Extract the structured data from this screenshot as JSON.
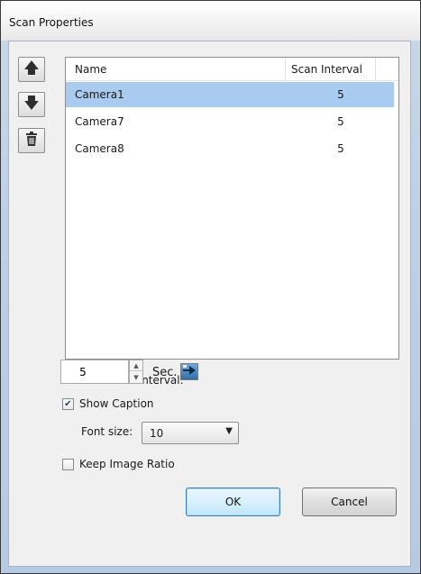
{
  "window": {
    "title": "Scan Properties"
  },
  "toolbar": {
    "move_up_icon": "arrow-up-icon",
    "move_down_icon": "arrow-down-icon",
    "delete_icon": "trash-icon"
  },
  "list": {
    "columns": [
      "Name",
      "Scan Interval"
    ],
    "rows": [
      {
        "name": "Camera1",
        "interval": "5",
        "selected": true
      },
      {
        "name": "Camera7",
        "interval": "5",
        "selected": false
      },
      {
        "name": "Camera8",
        "interval": "5",
        "selected": false
      }
    ]
  },
  "default_interval": {
    "label": "Default Scan Interval:",
    "value": "5",
    "unit": "Sec.",
    "apply_icon": "apply-to-all-icon"
  },
  "show_caption": {
    "label": "Show Caption",
    "checked": true
  },
  "font_size": {
    "label": "Font size:",
    "value": "10"
  },
  "keep_ratio": {
    "label": "Keep Image Ratio",
    "checked": false
  },
  "buttons": {
    "ok": "OK",
    "cancel": "Cancel"
  },
  "colors": {
    "selection": "#a8cbef",
    "default_button_border": "#3c7fb1"
  }
}
